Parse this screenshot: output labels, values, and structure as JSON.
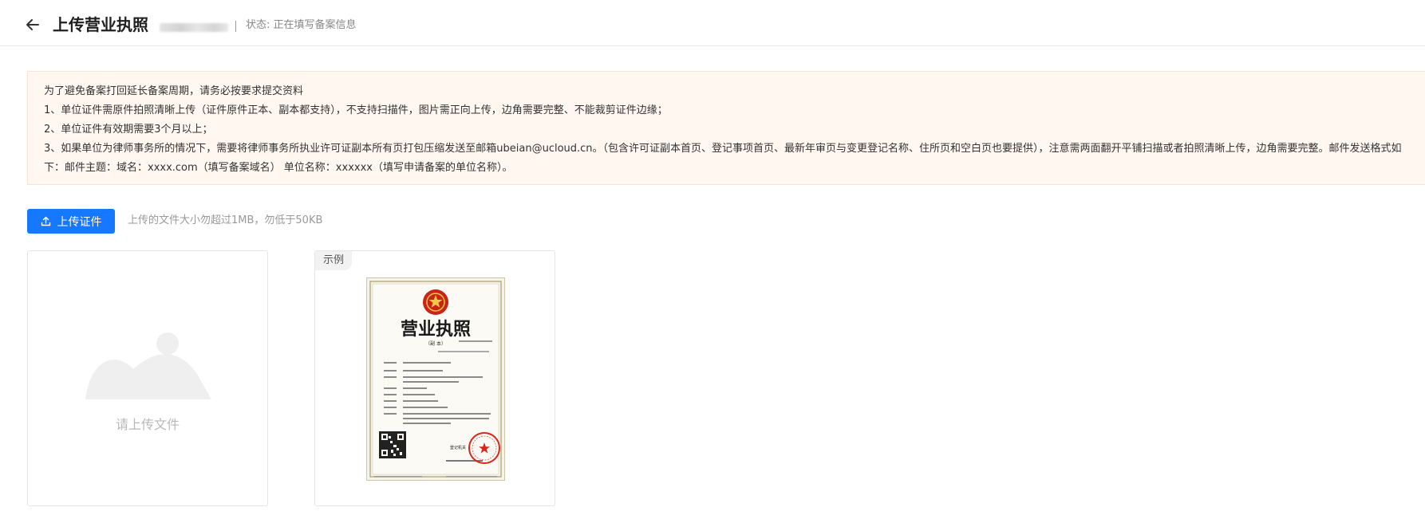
{
  "header": {
    "title": "上传营业执照",
    "status": "状态: 正在填写备案信息"
  },
  "notice": {
    "intro": "为了避免备案打回延长备案周期，请务必按要求提交资料",
    "items": [
      "1、单位证件需原件拍照清晰上传（证件原件正本、副本都支持），不支持扫描件，图片需正向上传，边角需要完整、不能裁剪证件边缘；",
      "2、单位证件有效期需要3个月以上；",
      "3、如果单位为律师事务所的情况下，需要将律师事务所执业许可证副本所有页打包压缩发送至邮箱ubeian@ucloud.cn。（包含许可证副本首页、登记事项首页、最新年审页与变更登记名称、住所页和空白页也要提供），注意需两面翻开平铺扫描或者拍照清晰上传，边角需要完整。邮件发送格式如下：邮件主题：域名：xxxx.com（填写备案域名） 单位名称：xxxxxx（填写申请备案的单位名称）。"
    ]
  },
  "upload": {
    "button_label": "上传证件",
    "tip": "上传的文件大小勿超过1MB，勿低于50KB",
    "placeholder_text": "请上传文件"
  },
  "sample": {
    "tag": "示例",
    "license_title": "营业执照",
    "license_subtitle": "（副 本）",
    "license_stamp_label": "登记机关"
  },
  "colors": {
    "primary": "#1677ff",
    "notice_bg": "#fff7f0",
    "stamp_red": "#d9261c"
  }
}
